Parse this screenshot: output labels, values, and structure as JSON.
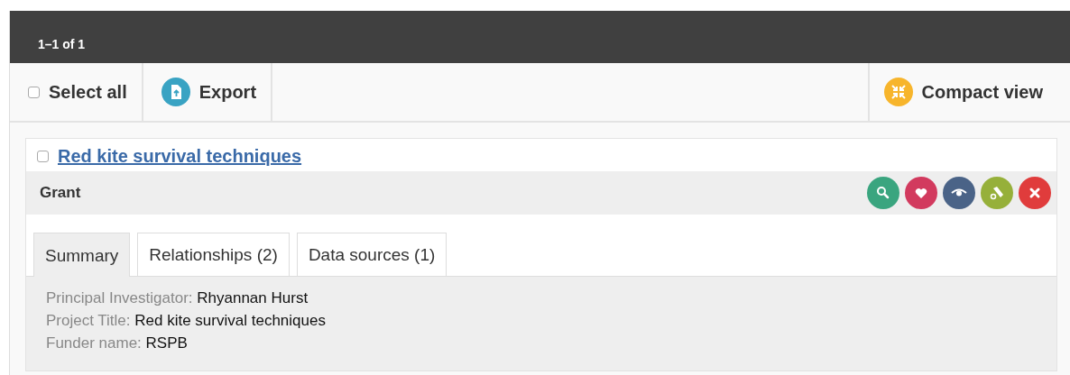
{
  "results_bar": {
    "count": "1–1 of 1"
  },
  "toolbar": {
    "select_all": {
      "label": "Select all",
      "checked": false
    },
    "export": {
      "label": "Export"
    },
    "compact_view": {
      "label": "Compact view"
    }
  },
  "record": {
    "checked": false,
    "title": "Red kite survival techniques",
    "type": "Grant",
    "actions": [
      {
        "kind": "search",
        "color": "#3aa57f"
      },
      {
        "kind": "favourite",
        "color": "#d23a5e"
      },
      {
        "kind": "view",
        "color": "#4a6387"
      },
      {
        "kind": "tool",
        "color": "#96b03a"
      },
      {
        "kind": "remove",
        "color": "#e03c3c"
      }
    ],
    "tabs": [
      {
        "label": "Summary",
        "selected": true
      },
      {
        "label": "Relationships (2)",
        "selected": false
      },
      {
        "label": "Data sources (1)",
        "selected": false
      }
    ],
    "fields": [
      {
        "label": "Principal Investigator:",
        "value": "Rhyannan Hurst"
      },
      {
        "label": "Project Title:",
        "value": "Red kite survival techniques"
      },
      {
        "label": "Funder name:",
        "value": "RSPB"
      }
    ]
  }
}
